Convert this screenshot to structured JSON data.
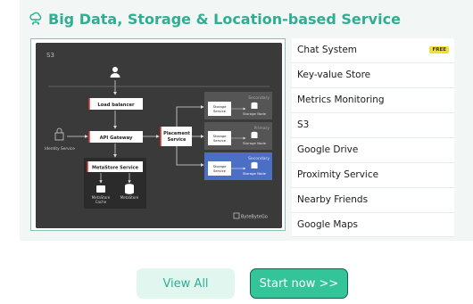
{
  "section": {
    "title": "Big Data, Storage & Location-based Service",
    "icon": "cloud-network-icon",
    "accent_color": "#2fae92"
  },
  "diagram": {
    "corner_label": "S3",
    "load_balancer": "Load balancer",
    "api_gateway": "API Gateway",
    "identity_service": "Identity Service",
    "placement_service_line1": "Placement",
    "placement_service_line2": "Service",
    "metastore_service": "MetaStore Service",
    "metastore_cache_line1": "MetaStore",
    "metastore_cache_line2": "Cache",
    "metastore": "MetaStore",
    "cluster_top_label": "Secondary",
    "cluster_mid_label": "Primary",
    "cluster_bottom_label": "Secondary",
    "storage_service_line1": "Storage",
    "storage_service_line2": "Service",
    "storage_node": "Storage Node",
    "watermark": "ByteByteGo"
  },
  "topics": [
    {
      "label": "Chat System",
      "badge": "FREE"
    },
    {
      "label": "Key-value Store"
    },
    {
      "label": "Metrics Monitoring"
    },
    {
      "label": "S3"
    },
    {
      "label": "Google Drive"
    },
    {
      "label": "Proximity Service"
    },
    {
      "label": "Nearby Friends"
    },
    {
      "label": "Google Maps"
    }
  ],
  "buttons": {
    "view_all": "View All",
    "start_now": "Start now >>"
  }
}
